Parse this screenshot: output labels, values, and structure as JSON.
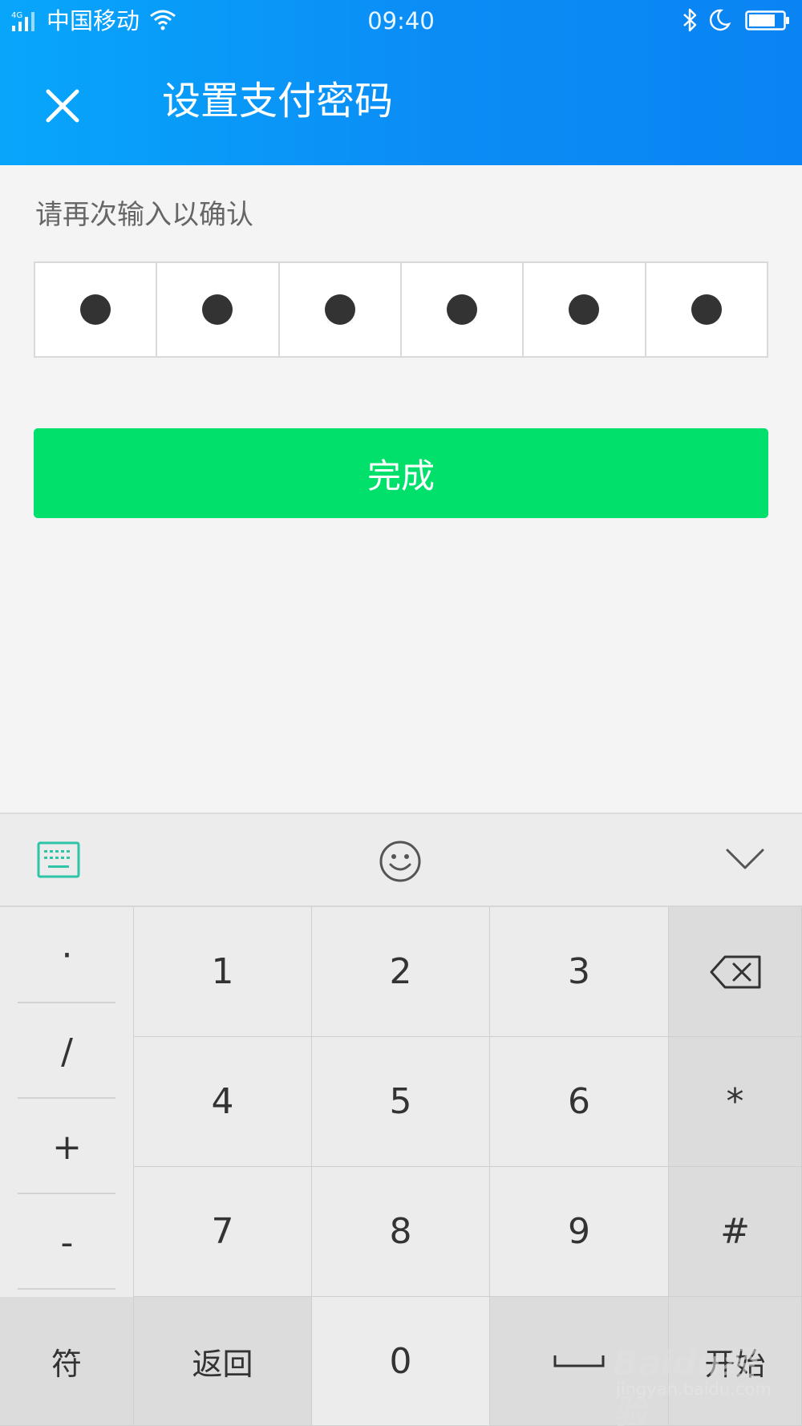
{
  "status_bar": {
    "network": "4G",
    "carrier": "中国移动",
    "time": "09:40"
  },
  "title_bar": {
    "title": "设置支付密码"
  },
  "form": {
    "prompt": "请再次输入以确认",
    "pin_length": 6,
    "pin_filled": 6,
    "done_label": "完成"
  },
  "keyboard": {
    "left_column": [
      "·",
      "/",
      "+",
      "-"
    ],
    "digits": [
      [
        "1",
        "2",
        "3"
      ],
      [
        "4",
        "5",
        "6"
      ],
      [
        "7",
        "8",
        "9"
      ]
    ],
    "right_column": [
      "*",
      "#"
    ],
    "bottom_row": {
      "symbols": "符",
      "back": "返回",
      "zero": "0",
      "start": "开始"
    }
  },
  "watermark": {
    "brand": "Baidu经验",
    "url": "jingyan.baidu.com"
  },
  "colors": {
    "header_start": "#07a6fb",
    "header_end": "#0a84f3",
    "done_button": "#00e06a",
    "icon_teal": "#2ec4a8"
  }
}
